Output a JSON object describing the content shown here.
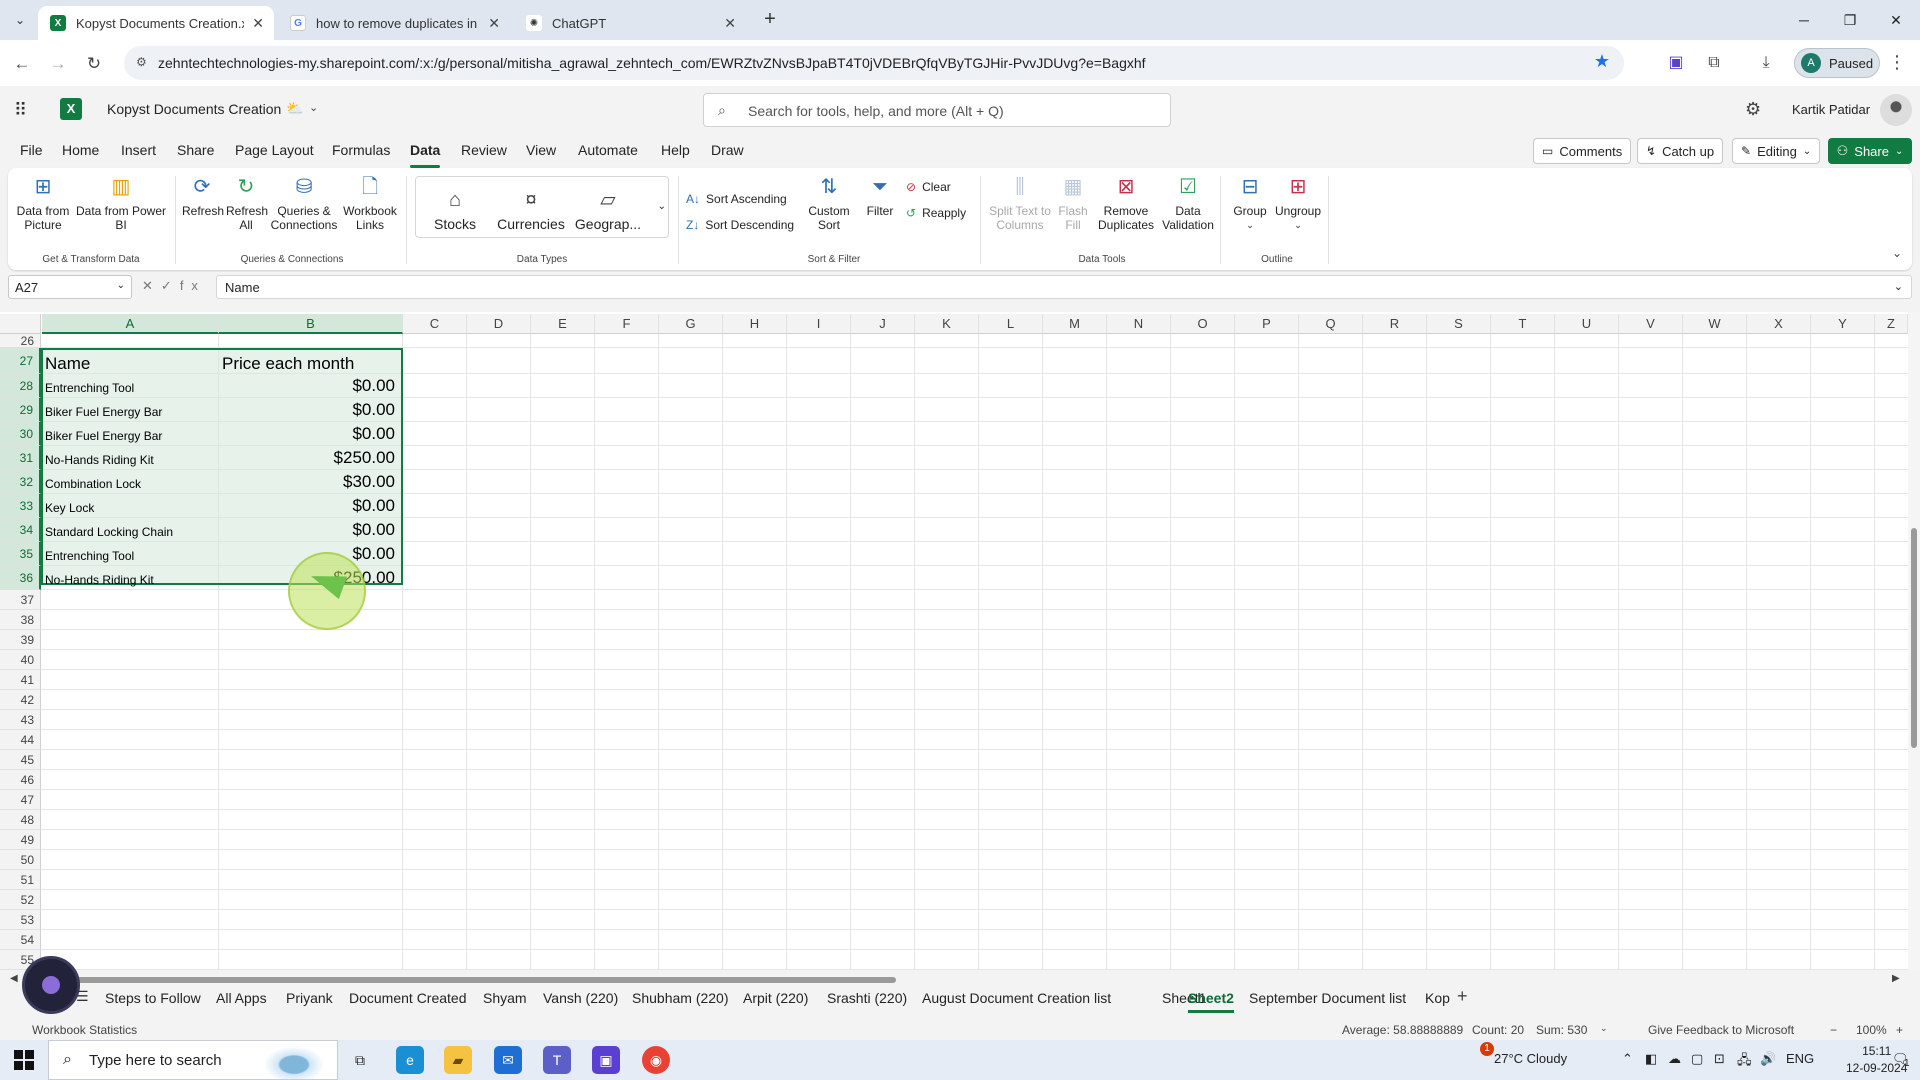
{
  "browser": {
    "tabs": [
      {
        "title": "Kopyst Documents Creation.xls",
        "favicon": "excel-icon",
        "active": true
      },
      {
        "title": "how to remove duplicates in ex",
        "favicon": "google-icon",
        "active": false
      },
      {
        "title": "ChatGPT",
        "favicon": "chatgpt-icon",
        "active": false
      }
    ],
    "url": "zehntechtechnologies-my.sharepoint.com/:x:/g/personal/mitisha_agrawal_zehntech_com/EWRZtvZNvsBJpaBT4T0jVDEBrQfqVByTGJHir-PvvJDUvg?e=Bagxhf",
    "profile_initial": "A",
    "profile_status": "Paused"
  },
  "app": {
    "logo": "X",
    "doc_title": "Kopyst Documents Creation",
    "search_placeholder": "Search for tools, help, and more (Alt + Q)",
    "user_name": "Kartik Patidar"
  },
  "menu": {
    "tabs": [
      "File",
      "Home",
      "Insert",
      "Share",
      "Page Layout",
      "Formulas",
      "Data",
      "Review",
      "View",
      "Automate",
      "Help",
      "Draw"
    ],
    "active": "Data",
    "comments": "Comments",
    "catch_up": "Catch up",
    "editing": "Editing",
    "share": "Share"
  },
  "ribbon": {
    "data_from_picture": "Data from Picture",
    "data_from_power_bi": "Data from Power BI",
    "get_transform_label": "Get & Transform Data",
    "refresh": "Refresh",
    "refresh_all": "Refresh All",
    "queries_connections": "Queries & Connections",
    "workbook_links": "Workbook Links",
    "queries_group_label": "Queries & Connections",
    "stocks": "Stocks",
    "currencies": "Currencies",
    "geography": "Geograp...",
    "data_types_label": "Data Types",
    "sort_ascending": "Sort Ascending",
    "sort_descending": "Sort Descending",
    "custom_sort": "Custom Sort",
    "filter": "Filter",
    "clear": "Clear",
    "reapply": "Reapply",
    "sort_filter_label": "Sort & Filter",
    "split_text": "Split Text to Columns",
    "flash_fill": "Flash Fill",
    "remove_duplicates": "Remove Duplicates",
    "data_validation": "Data Validation",
    "data_tools_label": "Data Tools",
    "group": "Group",
    "ungroup": "Ungroup",
    "outline_label": "Outline"
  },
  "formula_bar": {
    "name_box": "A27",
    "formula": "Name"
  },
  "sheet": {
    "columns": [
      "A",
      "B",
      "C",
      "D",
      "E",
      "F",
      "G",
      "H",
      "I",
      "J",
      "K",
      "L",
      "M",
      "N",
      "O",
      "P",
      "Q",
      "R",
      "S",
      "T",
      "U",
      "V",
      "W",
      "X",
      "Y",
      "Z"
    ],
    "rows": [
      "26",
      "27",
      "28",
      "29",
      "30",
      "31",
      "32",
      "33",
      "34",
      "35",
      "36",
      "37",
      "38",
      "39",
      "40",
      "41",
      "42",
      "43",
      "44",
      "45",
      "46",
      "47",
      "48",
      "49",
      "50",
      "51",
      "52",
      "53",
      "54",
      "55"
    ],
    "header": {
      "name": "Name",
      "price": "Price each month"
    },
    "data_rows": [
      {
        "row": "28",
        "name": "Entrenching Tool",
        "price": "$0.00"
      },
      {
        "row": "29",
        "name": "Biker Fuel Energy Bar",
        "price": "$0.00"
      },
      {
        "row": "30",
        "name": "Biker Fuel Energy Bar",
        "price": "$0.00"
      },
      {
        "row": "31",
        "name": "No-Hands Riding Kit",
        "price": "$250.00"
      },
      {
        "row": "32",
        "name": "Combination Lock",
        "price": "$30.00"
      },
      {
        "row": "33",
        "name": "Key Lock",
        "price": "$0.00"
      },
      {
        "row": "34",
        "name": "Standard Locking Chain",
        "price": "$0.00"
      },
      {
        "row": "35",
        "name": "Entrenching Tool",
        "price": "$0.00"
      },
      {
        "row": "36",
        "name": "No-Hands Riding Kit",
        "price": "$250.00"
      }
    ]
  },
  "sheet_tabs": {
    "tabs": [
      "Steps to Follow",
      "All Apps",
      "Priyank",
      "Document Created",
      "Shyam",
      "Vansh (220)",
      "Shubham (220)",
      "Arpit (220)",
      "Srashti (220)",
      "August Document Creation list",
      "Sheet1",
      "Sheet2",
      "September Document list",
      "Kop"
    ],
    "active": "Sheet2"
  },
  "status": {
    "workbook_statistics": "Workbook Statistics",
    "average": "Average: 58.88888889",
    "count": "Count: 20",
    "sum": "Sum: 530",
    "feedback": "Give Feedback to Microsoft",
    "zoom": "100%"
  },
  "taskbar": {
    "search_placeholder": "Type here to search",
    "weather_badge": "1",
    "weather": "27°C  Cloudy",
    "language": "ENG",
    "time": "15:11",
    "date": "12-09-2024",
    "notification_count": "1"
  },
  "colors": {
    "excel_green": "#107c41",
    "selection_fill": "#d3e8da",
    "chrome_star": "#1a73e8"
  }
}
